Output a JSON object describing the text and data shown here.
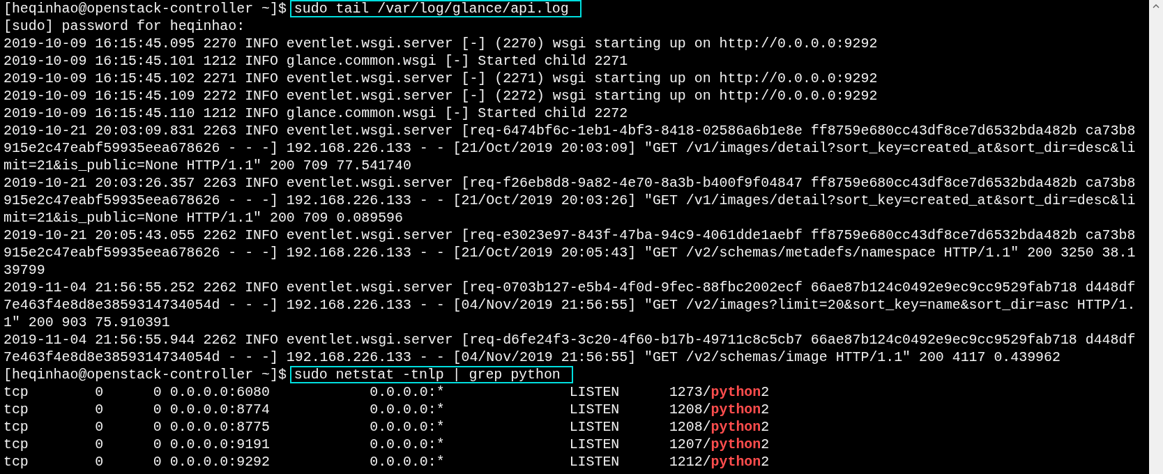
{
  "terminal": {
    "lines": [
      {
        "kind": "prompt",
        "prompt": "[heqinhao@openstack-controller ~]$",
        "command": "sudo tail /var/log/glance/api.log",
        "highlighted": true
      },
      {
        "kind": "output",
        "segments": [
          {
            "text": "[sudo] password for heqinhao:",
            "match": false
          }
        ]
      },
      {
        "kind": "output",
        "segments": [
          {
            "text": "2019-10-09 16:15:45.095 2270 INFO eventlet.wsgi.server [-] (2270) wsgi starting up on http://0.0.0.0:9292",
            "match": false
          }
        ]
      },
      {
        "kind": "output",
        "segments": [
          {
            "text": "2019-10-09 16:15:45.101 1212 INFO glance.common.wsgi [-] Started child 2271",
            "match": false
          }
        ]
      },
      {
        "kind": "output",
        "segments": [
          {
            "text": "2019-10-09 16:15:45.102 2271 INFO eventlet.wsgi.server [-] (2271) wsgi starting up on http://0.0.0.0:9292",
            "match": false
          }
        ]
      },
      {
        "kind": "output",
        "segments": [
          {
            "text": "2019-10-09 16:15:45.109 2272 INFO eventlet.wsgi.server [-] (2272) wsgi starting up on http://0.0.0.0:9292",
            "match": false
          }
        ]
      },
      {
        "kind": "output",
        "segments": [
          {
            "text": "2019-10-09 16:15:45.110 1212 INFO glance.common.wsgi [-] Started child 2272",
            "match": false
          }
        ]
      },
      {
        "kind": "output",
        "segments": [
          {
            "text": "2019-10-21 20:03:09.831 2263 INFO eventlet.wsgi.server [req-6474bf6c-1eb1-4bf3-8418-02586a6b1e8e ff8759e680cc43df8ce7d6532bda482b ca73b8",
            "match": false
          }
        ]
      },
      {
        "kind": "output",
        "segments": [
          {
            "text": "915e2c47eabf59935eea678626 - - -] 192.168.226.133 - - [21/Oct/2019 20:03:09] \"GET /v1/images/detail?sort_key=created_at&sort_dir=desc&li",
            "match": false
          }
        ]
      },
      {
        "kind": "output",
        "segments": [
          {
            "text": "mit=21&is_public=None HTTP/1.1\" 200 709 77.541740",
            "match": false
          }
        ]
      },
      {
        "kind": "output",
        "segments": [
          {
            "text": "2019-10-21 20:03:26.357 2263 INFO eventlet.wsgi.server [req-f26eb8d8-9a82-4e70-8a3b-b400f9f04847 ff8759e680cc43df8ce7d6532bda482b ca73b8",
            "match": false
          }
        ]
      },
      {
        "kind": "output",
        "segments": [
          {
            "text": "915e2c47eabf59935eea678626 - - -] 192.168.226.133 - - [21/Oct/2019 20:03:26] \"GET /v1/images/detail?sort_key=created_at&sort_dir=desc&li",
            "match": false
          }
        ]
      },
      {
        "kind": "output",
        "segments": [
          {
            "text": "mit=21&is_public=None HTTP/1.1\" 200 709 0.089596",
            "match": false
          }
        ]
      },
      {
        "kind": "output",
        "segments": [
          {
            "text": "2019-10-21 20:05:43.055 2262 INFO eventlet.wsgi.server [req-e3023e97-843f-47ba-94c9-4061dde1aebf ff8759e680cc43df8ce7d6532bda482b ca73b8",
            "match": false
          }
        ]
      },
      {
        "kind": "output",
        "segments": [
          {
            "text": "915e2c47eabf59935eea678626 - - -] 192.168.226.133 - - [21/Oct/2019 20:05:43] \"GET /v2/schemas/metadefs/namespace HTTP/1.1\" 200 3250 38.1",
            "match": false
          }
        ]
      },
      {
        "kind": "output",
        "segments": [
          {
            "text": "39799",
            "match": false
          }
        ]
      },
      {
        "kind": "output",
        "segments": [
          {
            "text": "2019-11-04 21:56:55.252 2262 INFO eventlet.wsgi.server [req-0703b127-e5b4-4f0d-9fec-88fbc2002ecf 66ae87b124c0492e9ec9cc9529fab718 d448df",
            "match": false
          }
        ]
      },
      {
        "kind": "output",
        "segments": [
          {
            "text": "7e463f4e8d8e3859314734054d - - -] 192.168.226.133 - - [04/Nov/2019 21:56:55] \"GET /v2/images?limit=20&sort_key=name&sort_dir=asc HTTP/1.",
            "match": false
          }
        ]
      },
      {
        "kind": "output",
        "segments": [
          {
            "text": "1\" 200 903 75.910391",
            "match": false
          }
        ]
      },
      {
        "kind": "output",
        "segments": [
          {
            "text": "2019-11-04 21:56:55.944 2262 INFO eventlet.wsgi.server [req-d6fe24f3-3c20-4f60-b17b-49711c8c5cb7 66ae87b124c0492e9ec9cc9529fab718 d448df",
            "match": false
          }
        ]
      },
      {
        "kind": "output",
        "segments": [
          {
            "text": "7e463f4e8d8e3859314734054d - - -] 192.168.226.133 - - [04/Nov/2019 21:56:55] \"GET /v2/schemas/image HTTP/1.1\" 200 4117 0.439962",
            "match": false
          }
        ]
      },
      {
        "kind": "prompt",
        "prompt": "[heqinhao@openstack-controller ~]$",
        "command": "sudo netstat -tnlp | grep python",
        "highlighted": true
      },
      {
        "kind": "output",
        "segments": [
          {
            "text": "tcp        0      0 0.0.0.0:6080            0.0.0.0:*               LISTEN      1273/",
            "match": false
          },
          {
            "text": "python",
            "match": true
          },
          {
            "text": "2",
            "match": false
          }
        ]
      },
      {
        "kind": "output",
        "segments": [
          {
            "text": "tcp        0      0 0.0.0.0:8774            0.0.0.0:*               LISTEN      1208/",
            "match": false
          },
          {
            "text": "python",
            "match": true
          },
          {
            "text": "2",
            "match": false
          }
        ]
      },
      {
        "kind": "output",
        "segments": [
          {
            "text": "tcp        0      0 0.0.0.0:8775            0.0.0.0:*               LISTEN      1208/",
            "match": false
          },
          {
            "text": "python",
            "match": true
          },
          {
            "text": "2",
            "match": false
          }
        ]
      },
      {
        "kind": "output",
        "segments": [
          {
            "text": "tcp        0      0 0.0.0.0:9191            0.0.0.0:*               LISTEN      1207/",
            "match": false
          },
          {
            "text": "python",
            "match": true
          },
          {
            "text": "2",
            "match": false
          }
        ]
      },
      {
        "kind": "output",
        "segments": [
          {
            "text": "tcp        0      0 0.0.0.0:9292            0.0.0.0:*               LISTEN      1212/",
            "match": false
          },
          {
            "text": "python",
            "match": true
          },
          {
            "text": "2",
            "match": false
          }
        ]
      }
    ]
  }
}
